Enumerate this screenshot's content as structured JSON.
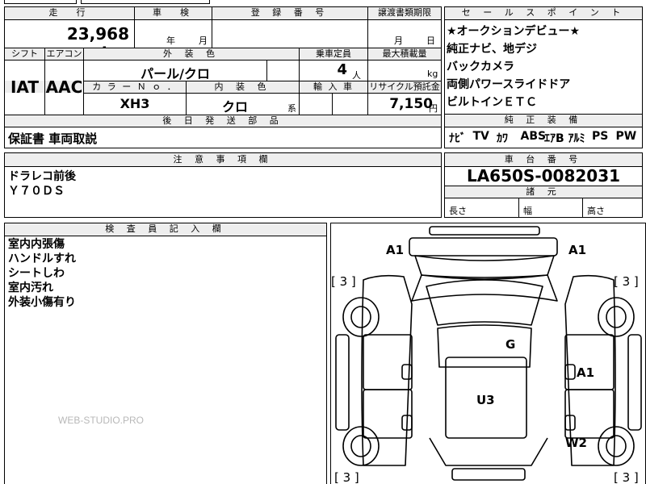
{
  "header": {
    "mileage": "走　行",
    "inspection": "車　検",
    "registration": "登 録 番 号",
    "transfer": "譲渡書類期限",
    "sales_points": "セ ー ル ス ポ イ ン ト"
  },
  "mileage": {
    "value": "23,968",
    "unit": "km"
  },
  "inspection": {
    "year_unit": "年",
    "month_unit": "月"
  },
  "transfer": {
    "month_unit": "月",
    "day_unit": "日"
  },
  "labels": {
    "shift": "シフト",
    "aircon": "エアコン",
    "exterior_color": "外 装 色",
    "capacity": "乗車定員",
    "max_load": "最大積載量",
    "color_no": "カ ラ ー Ｎ ｏ ．",
    "interior_color": "内 装 色",
    "import": "輸 入 車",
    "recycle": "リサイクル預託金",
    "later_parts": "後 日 発 送 部 品",
    "genuine_equipment": "純 正 装 備",
    "notes": "注 意 事 項 欄",
    "chassis_no": "車 台 番 号",
    "dimensions": "諸 元",
    "inspector_notes": "検 査 員 記 入 欄"
  },
  "shift": "IAT",
  "aircon": "AAC",
  "exterior_color": "パール/クロ",
  "capacity": {
    "value": "4",
    "unit": "人"
  },
  "max_load_unit": "kg",
  "color_no": "XH3",
  "interior_color": {
    "value": "クロ",
    "unit": "系"
  },
  "recycle": {
    "value": "7,150",
    "unit": "円"
  },
  "sales_points": [
    "★オークションデビュー★",
    "純正ナビ、地デジ",
    "バックカメラ",
    "両側パワースライドドア",
    "ビルトインＥＴＣ"
  ],
  "equipment": [
    "ﾅﾋﾞ",
    "TV",
    "ｶﾜ",
    "ABS",
    "ｴｱB",
    "ｱﾙﾐ",
    "PS",
    "PW"
  ],
  "later_parts_value": "保証書 車両取説",
  "notes_lines": [
    "ドラレコ前後",
    "Ｙ７０ＤＳ"
  ],
  "chassis_no": "LA650S-0082031",
  "dimensions": {
    "length": "長さ",
    "width": "幅",
    "height": "高さ"
  },
  "inspector_lines": [
    "室内内張傷",
    "ハンドルすれ",
    "シートしわ",
    "室内汚れ",
    "外装小傷有り"
  ],
  "watermark": "WEB-STUDIO.PRO",
  "diagram": {
    "marks": {
      "fl": "A1",
      "fr": "A1",
      "roof": "G",
      "right_door": "A1",
      "center": "U3",
      "rear_right": "W2"
    },
    "brackets": {
      "tl": "[ 3 ]",
      "tr": "[ 3 ]",
      "bl": "[ 3 ]",
      "br": "[ 3 ]"
    }
  }
}
